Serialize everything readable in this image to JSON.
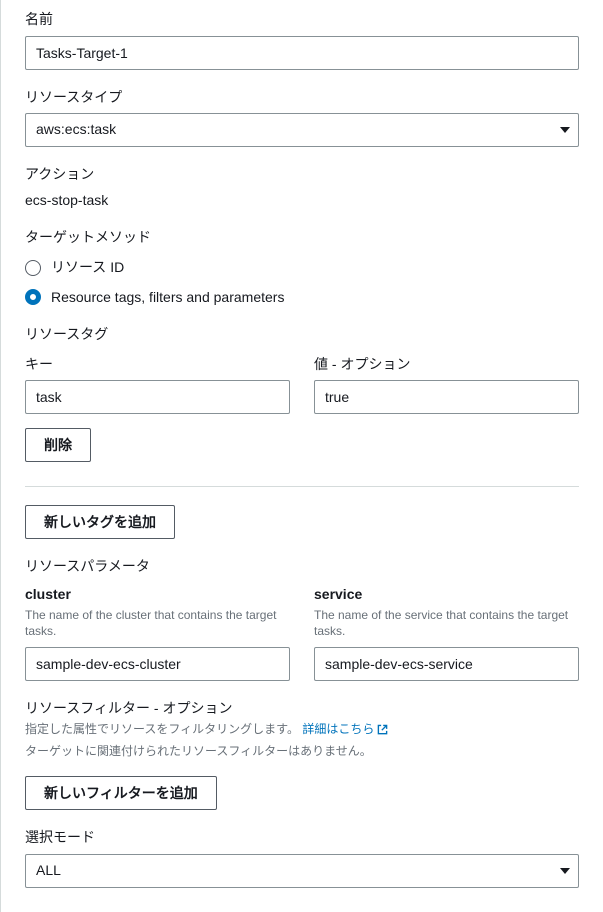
{
  "name": {
    "label": "名前",
    "value": "Tasks-Target-1"
  },
  "resourceType": {
    "label": "リソースタイプ",
    "value": "aws:ecs:task"
  },
  "action": {
    "label": "アクション",
    "value": "ecs-stop-task"
  },
  "targetMethod": {
    "label": "ターゲットメソッド",
    "options": [
      {
        "label": "リソース ID",
        "selected": false
      },
      {
        "label": "Resource tags, filters and parameters",
        "selected": true
      }
    ]
  },
  "resourceTags": {
    "label": "リソースタグ",
    "keyLabel": "キー",
    "valueLabel": "値 - オプション",
    "item": {
      "key": "task",
      "value": "true"
    },
    "deleteBtn": "削除",
    "addBtn": "新しいタグを追加"
  },
  "resourceParams": {
    "label": "リソースパラメータ",
    "cluster": {
      "label": "cluster",
      "help": "The name of the cluster that contains the target tasks.",
      "value": "sample-dev-ecs-cluster"
    },
    "service": {
      "label": "service",
      "help": "The name of the service that contains the target tasks.",
      "value": "sample-dev-ecs-service"
    }
  },
  "resourceFilters": {
    "label": "リソースフィルター - オプション",
    "help": "指定した属性でリソースをフィルタリングします。",
    "link": "詳細はこちら",
    "empty": "ターゲットに関連付けられたリソースフィルターはありません。",
    "addBtn": "新しいフィルターを追加"
  },
  "selectionMode": {
    "label": "選択モード",
    "value": "ALL"
  }
}
